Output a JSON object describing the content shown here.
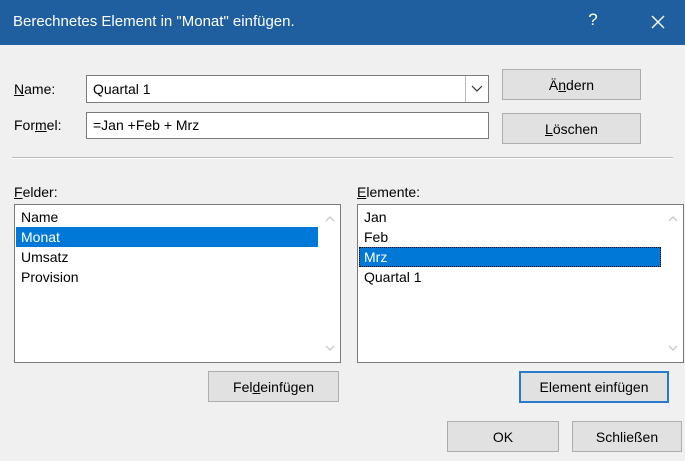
{
  "dialog": {
    "title": "Berechnetes Element in \"Monat\" einfügen.",
    "help_label": "?",
    "colors": {
      "titlebar": "#1f5fa0",
      "selection": "#0078d7",
      "default_border": "#2b79c9"
    }
  },
  "name_field": {
    "label_pre": "",
    "label_key": "N",
    "label_post": "ame:",
    "value": "Quartal 1"
  },
  "formula_field": {
    "label_pre": "For",
    "label_key": "m",
    "label_post": "el:",
    "value": "=Jan +Feb + Mrz"
  },
  "buttons": {
    "change": {
      "pre": "Ä",
      "key": "n",
      "post": "dern"
    },
    "delete": {
      "pre": "",
      "key": "L",
      "post": "öschen"
    },
    "insert_field": {
      "pre": "Fel",
      "key": "d",
      "post": " einfügen"
    },
    "insert_element": {
      "pre": "Element einfü",
      "key": "g",
      "post": "en"
    },
    "ok": "OK",
    "close": "Schließen"
  },
  "fields_list": {
    "label_pre": "",
    "label_key": "F",
    "label_post": "elder:",
    "items": [
      "Name",
      "Monat",
      "Umsatz",
      "Provision"
    ],
    "selected_index": 1
  },
  "elements_list": {
    "label_pre": "",
    "label_key": "E",
    "label_post": "lemente:",
    "items": [
      "Jan",
      "Feb",
      "Mrz",
      "Quartal 1"
    ],
    "selected_index": 2
  }
}
